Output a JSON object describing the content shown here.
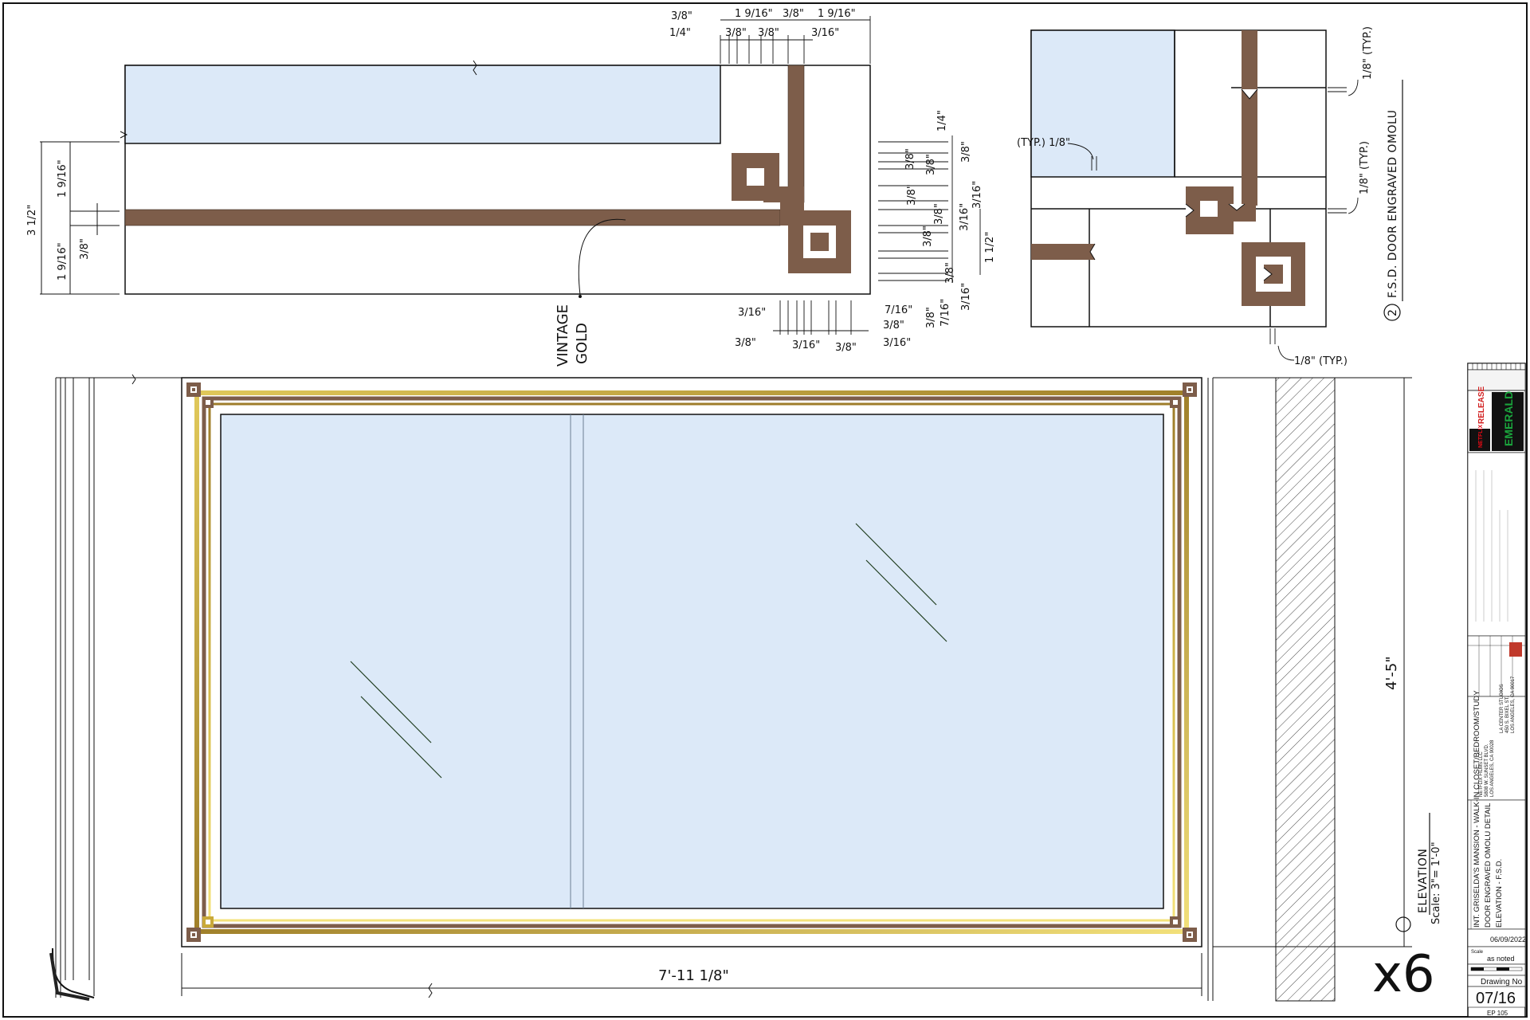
{
  "colors": {
    "glass": "#dce9f8",
    "bronze": "#7d5d4a",
    "gold": "#b8962e",
    "line": "#111111",
    "release_red": "#d11e1e",
    "emerald_green": "#1aa33c"
  },
  "detail_top": {
    "callout_label_1": "VINTAGE",
    "callout_label_2": "GOLD",
    "dim_3_1_2": "3 1/2\"",
    "dim_1_9_16_a": "1 9/16\"",
    "dim_1_9_16_b": "1 9/16\"",
    "dim_3_8_left": "3/8\"",
    "top_dims": {
      "a": "3/8\"",
      "b": "1 9/16\"",
      "c": "3/8\"",
      "d": "1 9/16\"",
      "e": "1/4\"",
      "f": "3/8\"",
      "g": "3/8\"",
      "h": "3/16\""
    },
    "bottom_dims": {
      "a": "3/16\"",
      "b": "7/16\"",
      "c": "3/8\"",
      "d": "3/8\"",
      "e": "3/16\"",
      "f": "3/8\"",
      "g": "3/16\""
    },
    "right_dims": {
      "a": "1/4\"",
      "b": "3/8\"",
      "c": "3/8\"",
      "d": "3/8\"",
      "e": "3/16\"",
      "f": "3/8\"",
      "g": "3/16\"",
      "h": "3/8\"",
      "i": "3/8\"",
      "j": "1 1/2\"",
      "k": "3/8\"",
      "l": "7/16\"",
      "m": "3/16\"",
      "n": "3/8\""
    }
  },
  "detail_corner": {
    "dim_typ_left": "(TYP.) 1/8\"",
    "dim_typ_right_1": "1/8\" (TYP.)",
    "dim_typ_right_2": "1/8\" (TYP.)",
    "dim_typ_bottom": "1/8\" (TYP.)",
    "detail_number": "2",
    "detail_title": "F.S.D. DOOR ENGRAVED OMOLU"
  },
  "elevation": {
    "width_dim": "7'-11 1/8\"",
    "height_dim": "4'-5\"",
    "title": "ELEVATION",
    "scale": "Scale: 3\"= 1'-0\"",
    "multiplier": "x6"
  },
  "title_block": {
    "project_line": "INT. GRISELDA'S MANSION - WALK-IN CLOSET/BEDROOM/STUDY",
    "sheet_line_1": "DOOR ENGRAVED OMOLU DETAIL",
    "sheet_line_2": "ELEVATION - F.S.D.",
    "release_label": "RELEASE",
    "network_label": "NETFLIX",
    "show_label": "EMERALD",
    "scale_label": "Scale",
    "scale_value": "as noted",
    "date_value": "06/09/2022",
    "drawing_no_label": "Drawing No",
    "drawing_no_value": "07/16",
    "sheet_code": "EP 105",
    "studio_lines": [
      "LA CENTER STUDIOS",
      "450 S. BIXEL ST.",
      "LOS ANGELES, CA 90017"
    ],
    "company_lines": [
      "NETFLIX FILMS LLC",
      "5808 W. SUNSET BLVD.",
      "LOS ANGELES, CA 90028"
    ]
  }
}
